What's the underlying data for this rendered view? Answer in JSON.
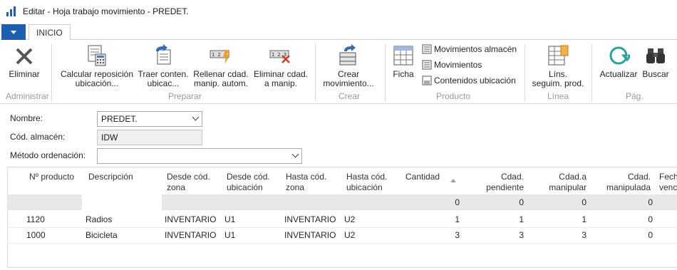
{
  "window": {
    "title": "Editar - Hoja trabajo movimiento - PREDET.",
    "icon": "excel-style-app-icon"
  },
  "ribbon": {
    "tab": "INICIO",
    "buttons": {
      "eliminar": "Eliminar",
      "calcular_l1": "Calcular reposición",
      "calcular_l2": "ubicación...",
      "traer_l1": "Traer conten.",
      "traer_l2": "ubicac...",
      "rellenar_l1": "Rellenar cdad.",
      "rellenar_l2": "manip. autom.",
      "eliminar_cdad_l1": "Eliminar cdad.",
      "eliminar_cdad_l2": "a manip.",
      "crear_l1": "Crear",
      "crear_l2": "movimiento...",
      "ficha": "Ficha",
      "movimientos_almacen": "Movimientos almacén",
      "movimientos": "Movimientos",
      "contenidos_ubicacion": "Contenidos ubicación",
      "lins_l1": "Líns.",
      "lins_l2": "seguim. prod.",
      "actualizar": "Actualizar",
      "buscar": "Buscar"
    },
    "groups": {
      "administrar": "Administrar",
      "preparar": "Preparar",
      "crear": "Crear",
      "producto": "Producto",
      "linea": "Línea",
      "pag": "Pág."
    }
  },
  "form": {
    "nombre_label": "Nombre:",
    "nombre_value": "PREDET.",
    "almacen_label": "Cód. almacén:",
    "almacen_value": "IDW",
    "metodo_label": "Método ordenación:",
    "metodo_value": ""
  },
  "grid": {
    "headers": {
      "producto": "Nº producto",
      "descripcion": "Descripción",
      "desde_zona_l1": "Desde cód.",
      "desde_zona_l2": "zona",
      "desde_ubic_l1": "Desde cód.",
      "desde_ubic_l2": "ubicación",
      "hasta_zona_l1": "Hasta cód.",
      "hasta_zona_l2": "zona",
      "hasta_ubic_l1": "Hasta cód.",
      "hasta_ubic_l2": "ubicación",
      "cantidad": "Cantidad",
      "pendiente_l1": "Cdad.",
      "pendiente_l2": "pendiente",
      "amanipular_l1": "Cdad.a",
      "amanipular_l2": "manipular",
      "manipulada_l1": "Cdad.",
      "manipulada_l2": "manipulada",
      "fecha_l1": "Fech",
      "fecha_l2": "venc"
    },
    "filter_row": {
      "cantidad": "0",
      "pendiente": "0",
      "amanipular": "0",
      "manipulada": "0"
    },
    "rows": [
      {
        "producto": "1120",
        "descripcion": "Radios",
        "desde_zona": "INVENTARIO",
        "desde_ubic": "U1",
        "hasta_zona": "INVENTARIO",
        "hasta_ubic": "U2",
        "cantidad": "1",
        "pendiente": "1",
        "amanipular": "1",
        "manipulada": "0"
      },
      {
        "producto": "1000",
        "descripcion": "Bicicleta",
        "desde_zona": "INVENTARIO",
        "desde_ubic": "U1",
        "hasta_zona": "INVENTARIO",
        "hasta_ubic": "U2",
        "cantidad": "3",
        "pendiente": "3",
        "amanipular": "3",
        "manipulada": "0"
      }
    ]
  }
}
